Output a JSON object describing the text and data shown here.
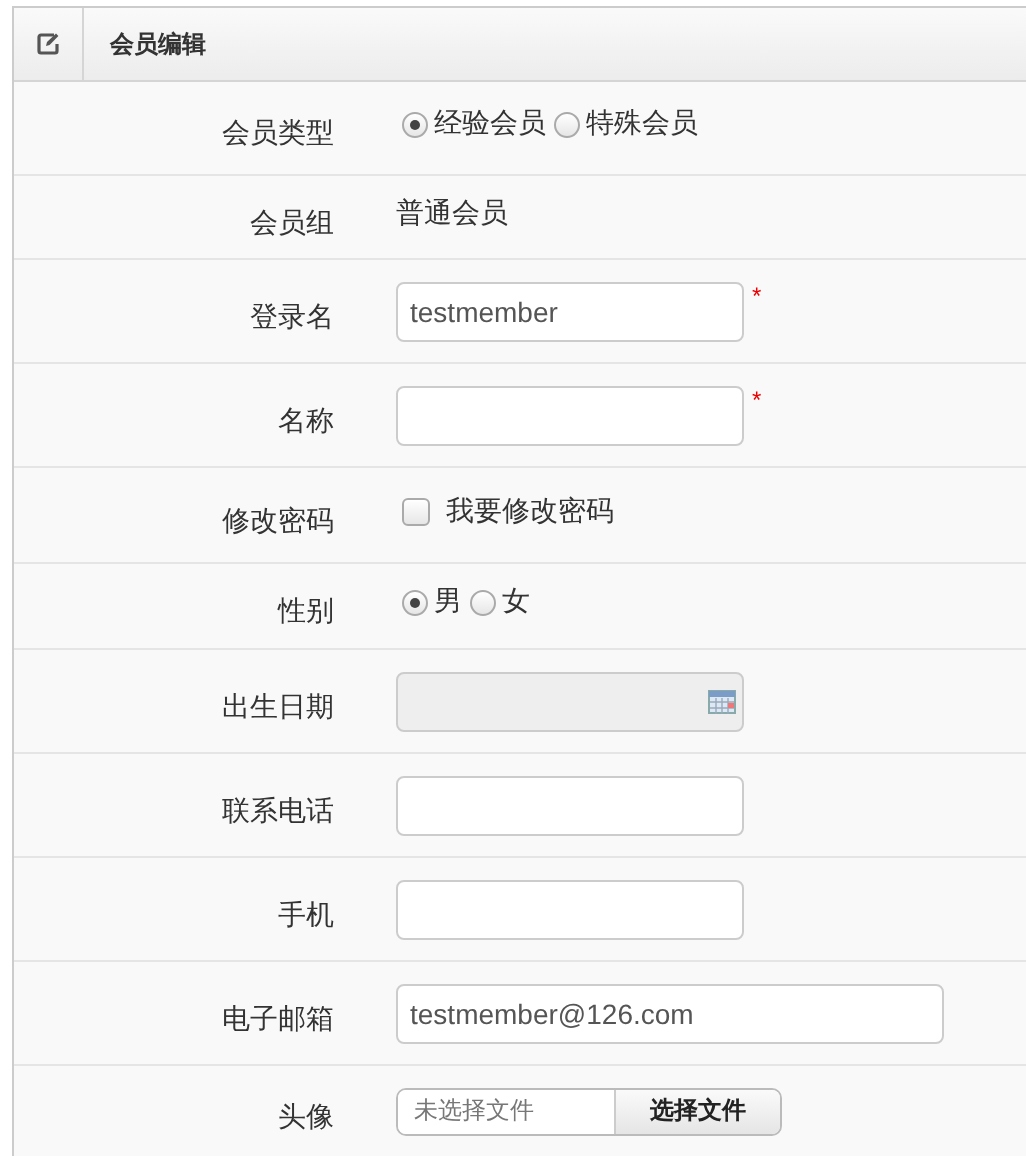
{
  "panel": {
    "title": "会员编辑"
  },
  "rows": [
    {
      "kind": "radio",
      "label": "会员类型",
      "options": [
        {
          "label": "经验会员",
          "selected": true
        },
        {
          "label": "特殊会员",
          "selected": false
        }
      ]
    },
    {
      "kind": "text",
      "label": "会员组",
      "value": "普通会员"
    },
    {
      "kind": "input",
      "label": "登录名",
      "value": "testmember",
      "required_mark": "*"
    },
    {
      "kind": "input",
      "label": "名称",
      "required_mark": "*"
    },
    {
      "kind": "checkbox",
      "label": "修改密码",
      "option": {
        "label": "我要修改密码",
        "checked": false
      }
    },
    {
      "kind": "radio",
      "label": "性别",
      "options": [
        {
          "label": "男",
          "selected": true
        },
        {
          "label": "女",
          "selected": false
        }
      ]
    },
    {
      "kind": "date",
      "label": "出生日期",
      "disabled": true
    },
    {
      "kind": "input",
      "label": "联系电话"
    },
    {
      "kind": "input",
      "label": "手机"
    },
    {
      "kind": "wide_input",
      "label": "电子邮箱",
      "value": "testmember@126.com"
    },
    {
      "kind": "file",
      "label": "头像",
      "status": "未选择文件",
      "button": "选择文件"
    }
  ]
}
